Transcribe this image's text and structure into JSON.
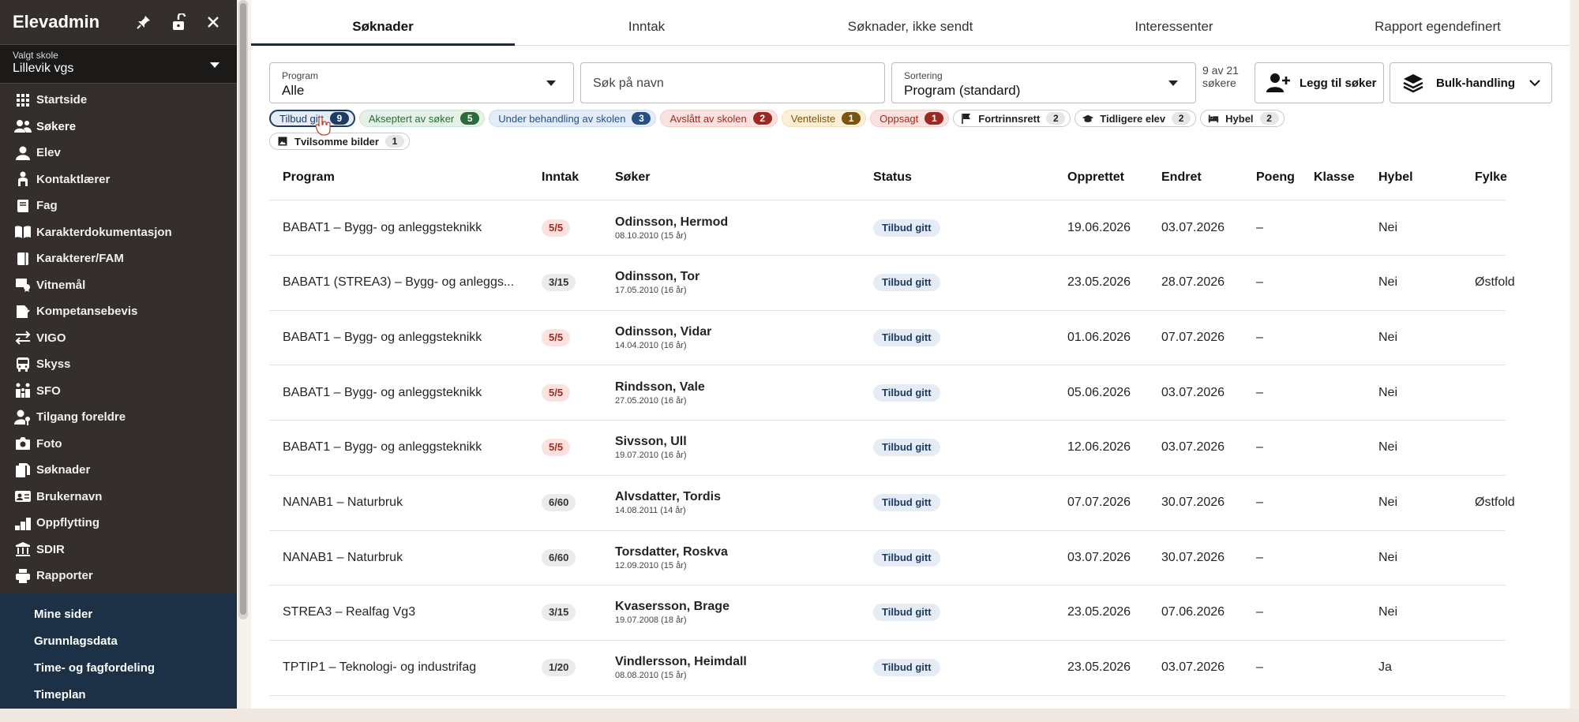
{
  "sidebar": {
    "title": "Elevadmin",
    "school_label": "Valgt skole",
    "school_value": "Lillevik vgs",
    "items": [
      {
        "label": "Startside",
        "icon": "grid-icon"
      },
      {
        "label": "Søkere",
        "icon": "people-icon"
      },
      {
        "label": "Elev",
        "icon": "person-icon"
      },
      {
        "label": "Kontaktlærer",
        "icon": "teacher-icon"
      },
      {
        "label": "Fag",
        "icon": "book-icon"
      },
      {
        "label": "Karakterdokumentasjon",
        "icon": "open-book-icon"
      },
      {
        "label": "Karakterer/FAM",
        "icon": "notebook-icon"
      },
      {
        "label": "Vitnemål",
        "icon": "diploma-icon"
      },
      {
        "label": "Kompetansebevis",
        "icon": "certificate-icon"
      },
      {
        "label": "VIGO",
        "icon": "swap-icon"
      },
      {
        "label": "Skyss",
        "icon": "bus-icon"
      },
      {
        "label": "SFO",
        "icon": "family-icon"
      },
      {
        "label": "Tilgang foreldre",
        "icon": "person-key-icon"
      },
      {
        "label": "Foto",
        "icon": "camera-icon"
      },
      {
        "label": "Søknader",
        "icon": "documents-icon"
      },
      {
        "label": "Brukernavn",
        "icon": "id-card-icon"
      },
      {
        "label": "Oppflytting",
        "icon": "level-up-icon"
      },
      {
        "label": "SDIR",
        "icon": "bank-icon"
      },
      {
        "label": "Rapporter",
        "icon": "printer-icon"
      }
    ],
    "sub_items": [
      "Mine sider",
      "Grunnlagsdata",
      "Time- og fagfordeling",
      "Timeplan"
    ]
  },
  "tabs": [
    "Søknader",
    "Inntak",
    "Søknader, ikke sendt",
    "Interessenter",
    "Rapport egendefinert"
  ],
  "filters": {
    "program_label": "Program",
    "program_value": "Alle",
    "search_placeholder": "Søk på navn",
    "sort_label": "Sortering",
    "sort_value": "Program (standard)",
    "count_text": "9 av 21 søkere",
    "add_button": "Legg til søker",
    "bulk_button": "Bulk-handling"
  },
  "chips": [
    {
      "label": "Tilbud gitt",
      "count": "9",
      "bg": "#e5ecf5",
      "border": "#1d3b63",
      "fg": "#1d3b63",
      "cbg": "#1d3b63",
      "cfg": "#ffffff"
    },
    {
      "label": "Akseptert av søker",
      "count": "5",
      "bg": "#e4f1e6",
      "border": "#cfe3d2",
      "fg": "#2c6a3a",
      "cbg": "#2c6a3a",
      "cfg": "#ffffff"
    },
    {
      "label": "Under behandling av skolen",
      "count": "3",
      "bg": "#e3ecf7",
      "border": "#cfdcee",
      "fg": "#284f86",
      "cbg": "#284f86",
      "cfg": "#ffffff"
    },
    {
      "label": "Avslått av skolen",
      "count": "2",
      "bg": "#fbe2df",
      "border": "#f2cdc8",
      "fg": "#9c2a22",
      "cbg": "#9c2a22",
      "cfg": "#ffffff"
    },
    {
      "label": "Venteliste",
      "count": "1",
      "bg": "#fcefd6",
      "border": "#f1dfb9",
      "fg": "#7a5410",
      "cbg": "#7a5410",
      "cfg": "#ffffff"
    },
    {
      "label": "Oppsagt",
      "count": "1",
      "bg": "#fbe2df",
      "border": "#f2cdc8",
      "fg": "#9c2a22",
      "cbg": "#9c2a22",
      "cfg": "#ffffff"
    },
    {
      "label": "Fortrinnsrett",
      "count": "2",
      "icon": "flag-icon",
      "bg": "#ffffff",
      "border": "#c9c9c9",
      "fg": "#222222",
      "cbg": "#e6e6e6",
      "cfg": "#222222"
    },
    {
      "label": "Tidligere elev",
      "count": "2",
      "icon": "graduation-cap-icon",
      "bg": "#ffffff",
      "border": "#c9c9c9",
      "fg": "#222222",
      "cbg": "#e6e6e6",
      "cfg": "#222222"
    },
    {
      "label": "Hybel",
      "count": "2",
      "icon": "bed-icon",
      "bg": "#ffffff",
      "border": "#c9c9c9",
      "fg": "#222222",
      "cbg": "#e6e6e6",
      "cfg": "#222222"
    },
    {
      "label": "Tvilsomme bilder",
      "count": "1",
      "icon": "image-icon",
      "bg": "#ffffff",
      "border": "#c9c9c9",
      "fg": "#222222",
      "cbg": "#e6e6e6",
      "cfg": "#222222"
    }
  ],
  "table": {
    "headers": [
      "Program",
      "Inntak",
      "Søker",
      "Status",
      "Opprettet",
      "Endret",
      "Poeng",
      "Klasse",
      "Hybel",
      "Fylke"
    ],
    "rows": [
      {
        "program": "BABAT1 – Bygg- og anleggsteknikk",
        "inntak": "5/5",
        "full": true,
        "name": "Odinsson, Hermod",
        "dob": "08.10.2010 (15 år)",
        "status": "Tilbud gitt",
        "opprettet": "19.06.2026",
        "endret": "03.07.2026",
        "poeng": "–",
        "klasse": "",
        "hybel": "Nei",
        "fylke": ""
      },
      {
        "program": "BABAT1 (STREA3) – Bygg- og anleggs...",
        "inntak": "3/15",
        "full": false,
        "name": "Odinsson, Tor",
        "dob": "17.05.2010 (16 år)",
        "status": "Tilbud gitt",
        "opprettet": "23.05.2026",
        "endret": "28.07.2026",
        "poeng": "–",
        "klasse": "",
        "hybel": "Nei",
        "fylke": "Østfold"
      },
      {
        "program": "BABAT1 – Bygg- og anleggsteknikk",
        "inntak": "5/5",
        "full": true,
        "name": "Odinsson, Vidar",
        "dob": "14.04.2010 (16 år)",
        "status": "Tilbud gitt",
        "opprettet": "01.06.2026",
        "endret": "07.07.2026",
        "poeng": "–",
        "klasse": "",
        "hybel": "Nei",
        "fylke": ""
      },
      {
        "program": "BABAT1 – Bygg- og anleggsteknikk",
        "inntak": "5/5",
        "full": true,
        "name": "Rindsson, Vale",
        "dob": "27.05.2010 (16 år)",
        "status": "Tilbud gitt",
        "opprettet": "05.06.2026",
        "endret": "03.07.2026",
        "poeng": "–",
        "klasse": "",
        "hybel": "Nei",
        "fylke": ""
      },
      {
        "program": "BABAT1 – Bygg- og anleggsteknikk",
        "inntak": "5/5",
        "full": true,
        "name": "Sivsson, Ull",
        "dob": "19.07.2010 (16 år)",
        "status": "Tilbud gitt",
        "opprettet": "12.06.2026",
        "endret": "03.07.2026",
        "poeng": "–",
        "klasse": "",
        "hybel": "Nei",
        "fylke": ""
      },
      {
        "program": "NANAB1 – Naturbruk",
        "inntak": "6/60",
        "full": false,
        "name": "Alvsdatter, Tordis",
        "dob": "14.08.2011 (14 år)",
        "status": "Tilbud gitt",
        "opprettet": "07.07.2026",
        "endret": "30.07.2026",
        "poeng": "–",
        "klasse": "",
        "hybel": "Nei",
        "fylke": "Østfold"
      },
      {
        "program": "NANAB1 – Naturbruk",
        "inntak": "6/60",
        "full": false,
        "name": "Torsdatter, Roskva",
        "dob": "12.09.2010 (15 år)",
        "status": "Tilbud gitt",
        "opprettet": "03.07.2026",
        "endret": "30.07.2026",
        "poeng": "–",
        "klasse": "",
        "hybel": "Nei",
        "fylke": ""
      },
      {
        "program": "STREA3 – Realfag Vg3",
        "inntak": "3/15",
        "full": false,
        "name": "Kvasersson, Brage",
        "dob": "19.07.2008 (18 år)",
        "status": "Tilbud gitt",
        "opprettet": "23.05.2026",
        "endret": "07.06.2026",
        "poeng": "–",
        "klasse": "",
        "hybel": "Nei",
        "fylke": ""
      },
      {
        "program": "TPTIP1 – Teknologi- og industrifag",
        "inntak": "1/20",
        "full": false,
        "name": "Vindlersson, Heimdall",
        "dob": "08.08.2010 (15 år)",
        "status": "Tilbud gitt",
        "opprettet": "23.05.2026",
        "endret": "03.07.2026",
        "poeng": "–",
        "klasse": "",
        "hybel": "Ja",
        "fylke": ""
      }
    ]
  }
}
